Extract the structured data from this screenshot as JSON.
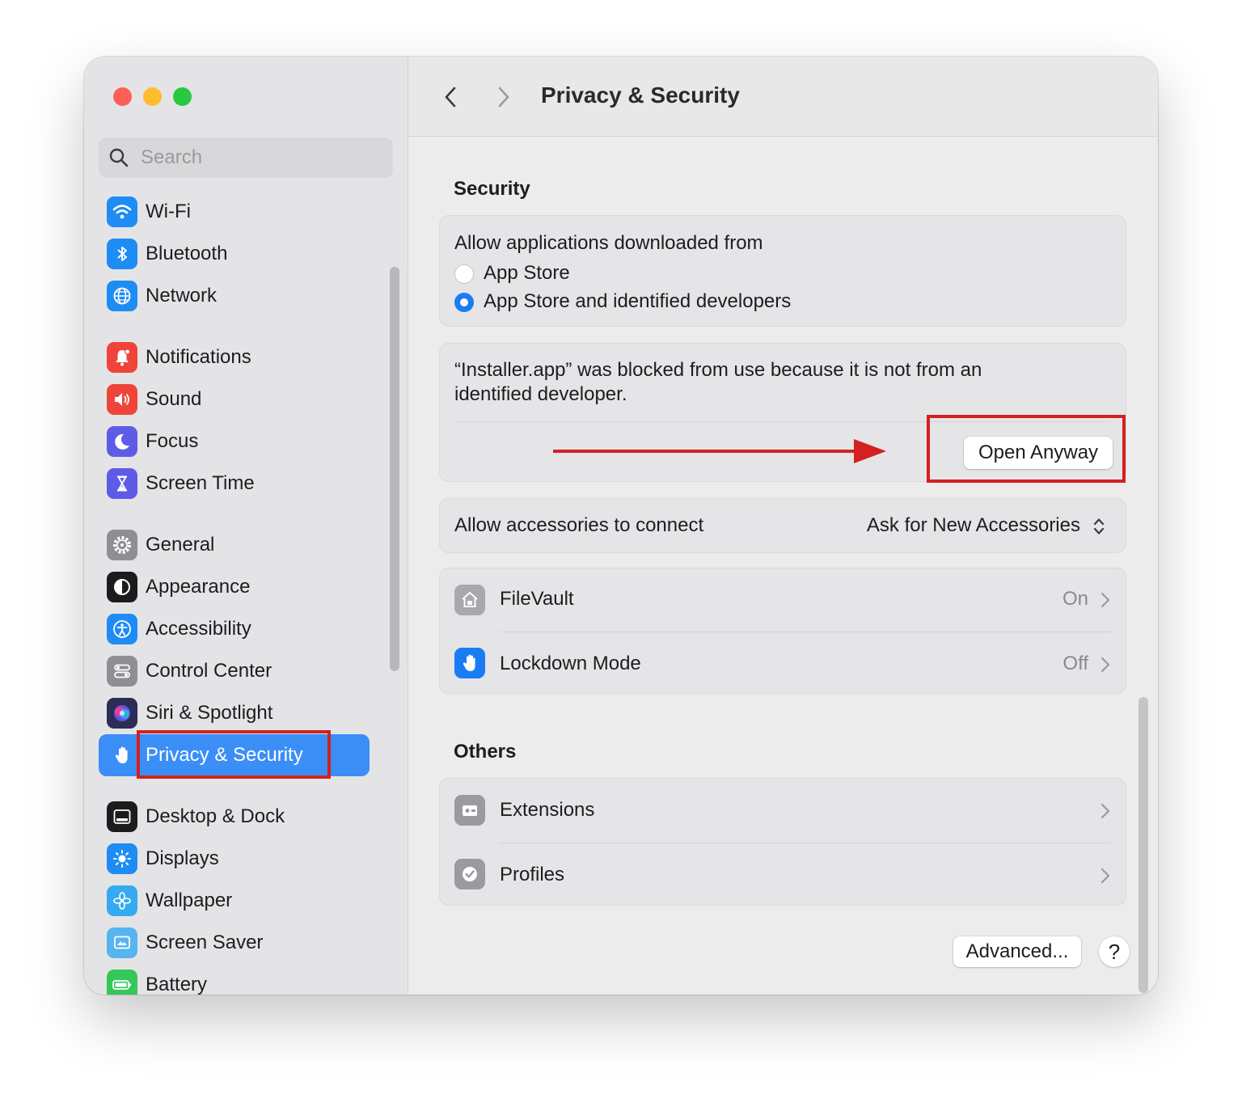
{
  "sidebar": {
    "search_placeholder": "Search",
    "items": [
      {
        "label": "Wi-Fi",
        "icon": "wifi-icon",
        "color": "#1e8cf5"
      },
      {
        "label": "Bluetooth",
        "icon": "bluetooth-icon",
        "color": "#1e8cf5"
      },
      {
        "label": "Network",
        "icon": "globe-icon",
        "color": "#1e8cf5"
      },
      {
        "label": "Notifications",
        "icon": "bell-icon",
        "color": "#f0443a"
      },
      {
        "label": "Sound",
        "icon": "speaker-icon",
        "color": "#f0443a"
      },
      {
        "label": "Focus",
        "icon": "moon-icon",
        "color": "#5e5ce6"
      },
      {
        "label": "Screen Time",
        "icon": "hourglass-icon",
        "color": "#5e5ce6"
      },
      {
        "label": "General",
        "icon": "gear-icon",
        "color": "#8e8e93"
      },
      {
        "label": "Appearance",
        "icon": "appearance-icon",
        "color": "#1c1c1e"
      },
      {
        "label": "Accessibility",
        "icon": "accessibility-icon",
        "color": "#1e8cf5"
      },
      {
        "label": "Control Center",
        "icon": "toggles-icon",
        "color": "#8e8e93"
      },
      {
        "label": "Siri & Spotlight",
        "icon": "siri-icon",
        "color": "#2c2c54"
      },
      {
        "label": "Privacy & Security",
        "icon": "hand-icon",
        "color": "#3a8ef6"
      },
      {
        "label": "Desktop & Dock",
        "icon": "dock-icon",
        "color": "#1c1c1e"
      },
      {
        "label": "Displays",
        "icon": "sun-icon",
        "color": "#1e8cf5"
      },
      {
        "label": "Wallpaper",
        "icon": "flower-icon",
        "color": "#36aaf0"
      },
      {
        "label": "Screen Saver",
        "icon": "screen-saver-icon",
        "color": "#56b4f0"
      },
      {
        "label": "Battery",
        "icon": "battery-icon",
        "color": "#34c759"
      }
    ]
  },
  "titlebar": {
    "title": "Privacy & Security"
  },
  "security": {
    "heading": "Security",
    "allow_label": "Allow applications downloaded from",
    "options": [
      "App Store",
      "App Store and identified developers"
    ],
    "selected_option": "App Store and identified developers",
    "blocked_message": "“Installer.app” was blocked from use because it is not from an identified developer.",
    "open_anyway": "Open Anyway",
    "accessories_label": "Allow accessories to connect",
    "accessories_value": "Ask for New Accessories",
    "filevault_label": "FileVault",
    "filevault_value": "On",
    "lockdown_label": "Lockdown Mode",
    "lockdown_value": "Off"
  },
  "others": {
    "heading": "Others",
    "items": [
      "Extensions",
      "Profiles"
    ]
  },
  "footer": {
    "advanced": "Advanced...",
    "help": "?"
  },
  "colors": {
    "accent": "#3a8ef6",
    "annotation": "#d42020"
  }
}
